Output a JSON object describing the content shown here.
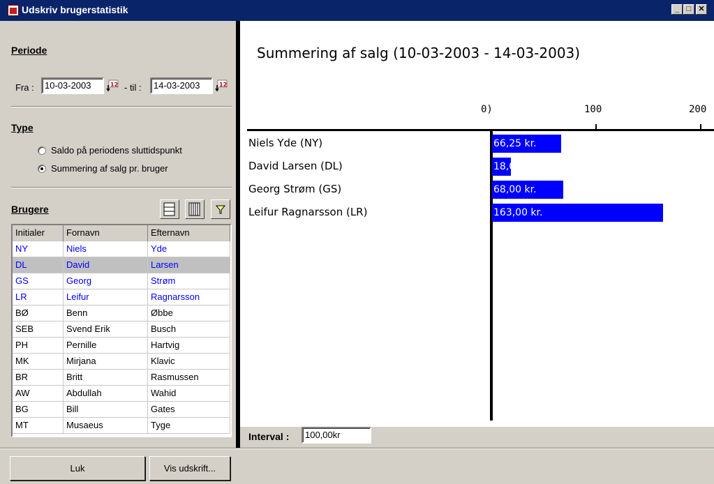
{
  "window": {
    "title": "Udskriv brugerstatistik",
    "buttons": {
      "minimize": "_",
      "maximize": "□",
      "close": "✕"
    }
  },
  "periode": {
    "heading": "Periode",
    "from_label": "Fra :",
    "from_value": "10-03-2003",
    "to_label": "- til :",
    "to_value": "14-03-2003",
    "calendar_badge": "12"
  },
  "type": {
    "heading": "Type",
    "options": [
      {
        "label": "Saldo på periodens sluttidspunkt",
        "selected": false
      },
      {
        "label": "Summering af salg pr. bruger",
        "selected": true
      }
    ]
  },
  "brugere": {
    "heading": "Brugere",
    "columns": [
      "Initialer",
      "Fornavn",
      "Efternavn"
    ],
    "rows": [
      [
        "NY",
        "Niels",
        "Yde"
      ],
      [
        "DL",
        "David",
        "Larsen"
      ],
      [
        "GS",
        "Georg",
        "Strøm"
      ],
      [
        "LR",
        "Leifur",
        "Ragnarsson"
      ],
      [
        "BØ",
        "Benn",
        "Øbbe"
      ],
      [
        "SEB",
        "Svend Erik",
        "Busch"
      ],
      [
        "PH",
        "Pernille",
        "Hartvig"
      ],
      [
        "MK",
        "Mirjana",
        "Klavic"
      ],
      [
        "BR",
        "Britt",
        "Rasmussen"
      ],
      [
        "AW",
        "Abdullah",
        "Wahid"
      ],
      [
        "BG",
        "Bill",
        "Gates"
      ],
      [
        "MT",
        "Musaeus",
        "Tyge"
      ]
    ],
    "highlighted_rows": [
      0,
      1,
      2,
      3
    ],
    "selected_row": 1
  },
  "interval": {
    "label": "Interval :",
    "value": "100,00kr"
  },
  "buttons": {
    "close": "Luk",
    "print": "Vis udskrift..."
  },
  "colors": {
    "bar": "#0000ff",
    "highlight_text": "#0000ff",
    "titlebar": "#0a246a"
  },
  "chart_data": {
    "type": "bar",
    "orientation": "horizontal",
    "title": "Summering af salg (10-03-2003 - 14-03-2003)",
    "categories": [
      "Niels Yde (NY)",
      "David Larsen (DL)",
      "Georg Strøm (GS)",
      "Leifur Ragnarsson (LR)"
    ],
    "values": [
      66.25,
      18.0,
      68.0,
      163.0
    ],
    "value_labels": [
      "66,25 kr.",
      "18,00 kr.",
      "68,00 kr.",
      "163,00 kr."
    ],
    "ticks": [
      0,
      100,
      200
    ],
    "tick_labels": [
      "0)",
      "100",
      "200"
    ]
  }
}
